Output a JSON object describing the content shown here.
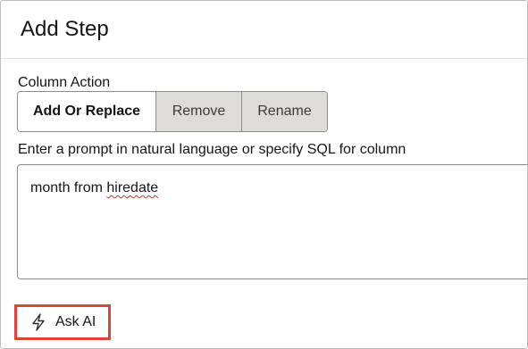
{
  "dialog": {
    "title": "Add Step"
  },
  "column_action": {
    "label": "Column Action",
    "options": [
      {
        "label": "Add Or Replace",
        "selected": true
      },
      {
        "label": "Remove",
        "selected": false
      },
      {
        "label": "Rename",
        "selected": false
      }
    ]
  },
  "prompt": {
    "label": "Enter a prompt in natural language or specify SQL for column",
    "value_prefix": "month from ",
    "value_misspelled": "hiredate"
  },
  "ask_ai": {
    "label": "Ask AI",
    "icon": "lightning-bolt-icon",
    "highlight_color": "#e0413b"
  }
}
